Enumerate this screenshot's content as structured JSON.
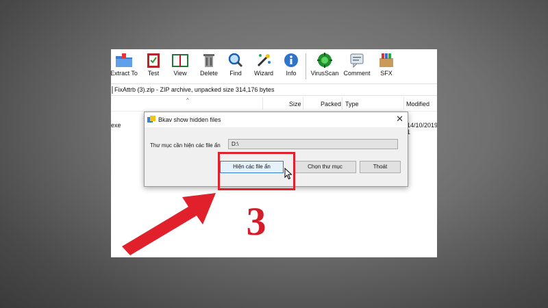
{
  "toolbar": {
    "buttons": [
      {
        "label": "Extract To",
        "icon": "folder-extract-icon"
      },
      {
        "label": "Test",
        "icon": "clipboard-check-icon"
      },
      {
        "label": "View",
        "icon": "book-view-icon"
      },
      {
        "label": "Delete",
        "icon": "trash-icon"
      },
      {
        "label": "Find",
        "icon": "magnifier-icon"
      },
      {
        "label": "Wizard",
        "icon": "magic-wand-icon"
      },
      {
        "label": "Info",
        "icon": "info-icon"
      },
      {
        "label": "VirusScan",
        "icon": "virus-scan-icon"
      },
      {
        "label": "Comment",
        "icon": "comment-icon"
      },
      {
        "label": "SFX",
        "icon": "sfx-box-icon"
      }
    ]
  },
  "pathbar": {
    "text": "FixAttrb (3).zip - ZIP archive, unpacked size 314,176 bytes"
  },
  "file_list": {
    "columns": [
      "Size",
      "Packed",
      "Type",
      "Modified"
    ],
    "rows": [
      {
        "name_fragment": "exe",
        "modified_fragment": "14/10/2019 1"
      }
    ],
    "sort_indicator": "^"
  },
  "dialog": {
    "title": "Bkav show hidden files",
    "close_glyph": "✕",
    "folder_label": "Thư mục cần hiện các file ẩn",
    "folder_value": "D:\\",
    "buttons": {
      "show": "Hiện các file ẩn",
      "choose": "Chọn thư mục",
      "exit": "Thoát"
    }
  },
  "annotation": {
    "step_number": "3",
    "color": "#d41d28"
  },
  "colors": {
    "accent_blue": "#2f7bd0",
    "annotation_red": "#e0202a"
  }
}
